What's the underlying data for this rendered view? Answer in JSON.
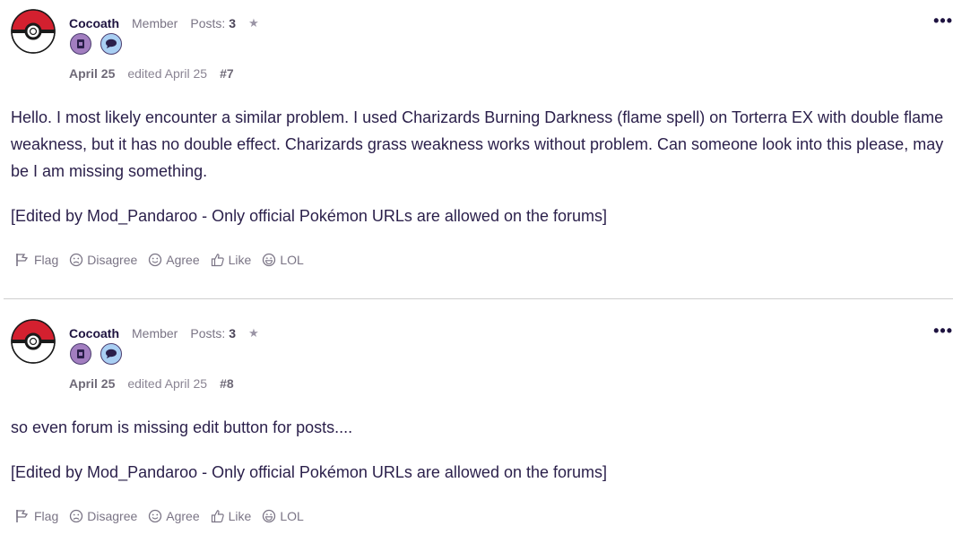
{
  "posts": [
    {
      "author": "Cocoath",
      "role": "Member",
      "posts_label": "Posts:",
      "posts_count": "3",
      "star": "★",
      "date": "April 25",
      "edited": "edited April 25",
      "permalink": "#7",
      "more": "•••",
      "paragraphs": [
        "Hello. I most likely encounter a similar problem. I used Charizards Burning Darkness (flame spell) on Torterra EX with double flame weakness, but it has no double effect. Charizards grass weakness works without problem. Can someone look into this please, may be I am missing something.",
        "[Edited by Mod_Pandaroo - Only official Pokémon URLs are allowed on the forums]"
      ],
      "reactions": [
        "Flag",
        "Disagree",
        "Agree",
        "Like",
        "LOL"
      ]
    },
    {
      "author": "Cocoath",
      "role": "Member",
      "posts_label": "Posts:",
      "posts_count": "3",
      "star": "★",
      "date": "April 25",
      "edited": "edited April 25",
      "permalink": "#8",
      "more": "•••",
      "paragraphs": [
        "so even forum is missing edit button for posts....",
        "[Edited by Mod_Pandaroo - Only official Pokémon URLs are allowed on the forums]"
      ],
      "reactions": [
        "Flag",
        "Disagree",
        "Agree",
        "Like",
        "LOL"
      ]
    }
  ],
  "colors": {
    "text": "#2a1f4a",
    "muted": "#7a7485",
    "pokeball_red": "#d3202f",
    "badge_purple": "#a27ec0",
    "badge_blue": "#a9cff3"
  }
}
